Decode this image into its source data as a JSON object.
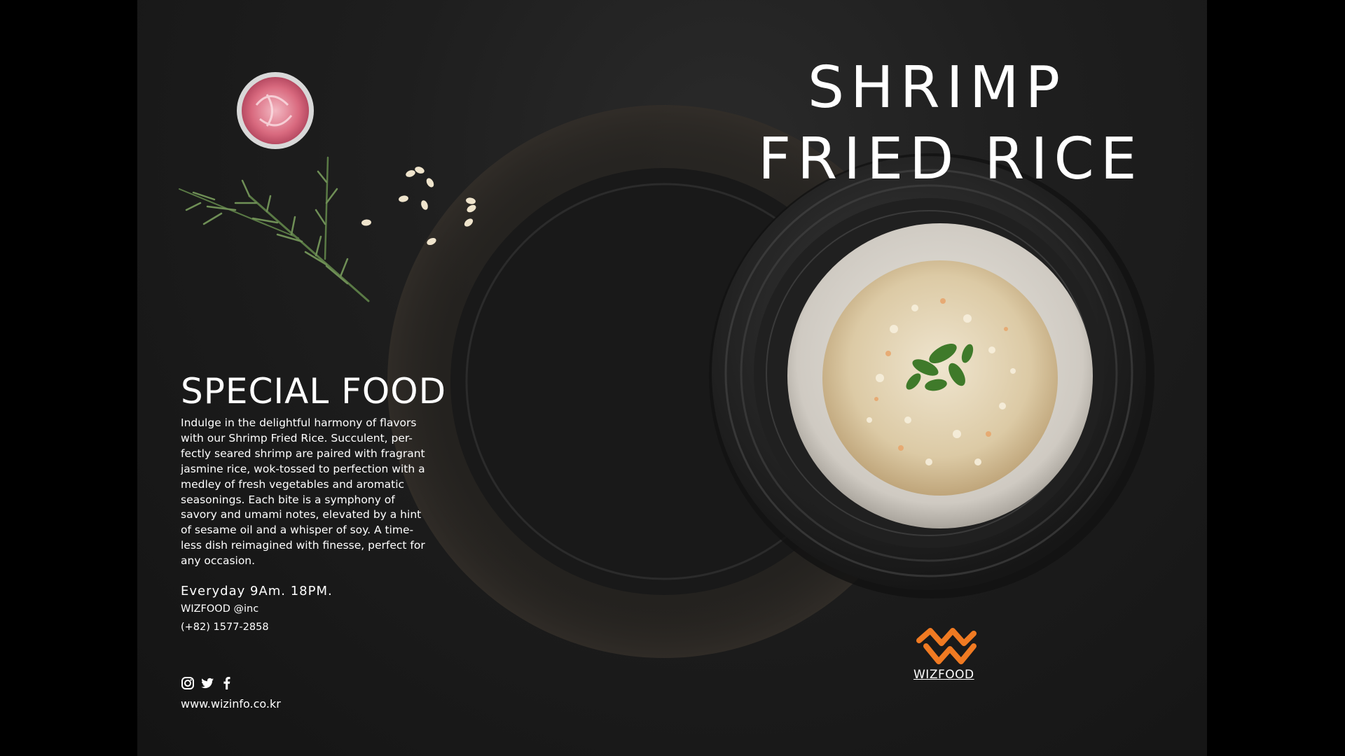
{
  "poster": {
    "title_line_1": "SHRIMP",
    "title_line_2": "FRIED RICE",
    "section_heading": "SPECIAL FOOD",
    "description_lines": [
      "Indulge in the delightful harmony of flavors",
      "with our Shrimp Fried Rice. Succulent, per-",
      "fectly seared shrimp are paired with fragrant",
      "jasmine rice, wok-tossed to perfection with a",
      "medley of fresh vegetables and aromatic",
      "seasonings. Each bite is a symphony of",
      "savory and umami notes, elevated by a hint",
      "of sesame oil and a whisper of soy. A time-",
      "less dish reimagined with finesse, perfect for",
      "any occasion."
    ],
    "hours": "Everyday 9Am. 18PM.",
    "company": "WIZFOOD @inc",
    "phone": "(+82) 1577-2858",
    "website": "www.wizinfo.co.kr",
    "logo_text": "WIZFOOD"
  },
  "icons": {
    "social": [
      "instagram-icon",
      "twitter-icon",
      "facebook-icon"
    ],
    "logo": "wizfood-logo-icon"
  },
  "colors": {
    "background": "#1b1b1b",
    "text": "#ffffff",
    "logo_accent": "#f07a22"
  }
}
